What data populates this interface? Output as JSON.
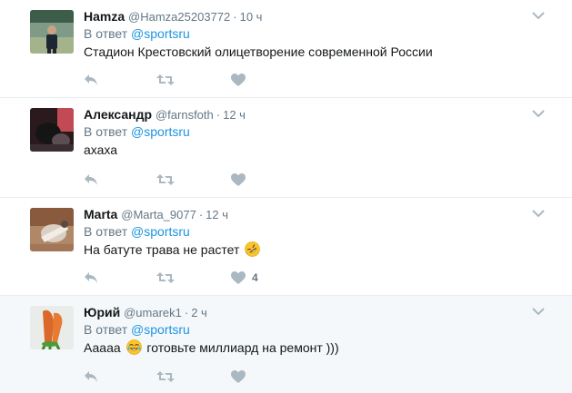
{
  "tweets": [
    {
      "name": "Hamza",
      "handle": "@Hamza25203772",
      "time": "10 ч",
      "reply_prefix": "В ответ",
      "reply_to": "@sportsru",
      "text": "Стадион Крестовский олицетворение современной России",
      "emoji": "",
      "text_after": "",
      "like_count": "",
      "highlighted": false
    },
    {
      "name": "Александр",
      "handle": "@farnsfoth",
      "time": "12 ч",
      "reply_prefix": "В ответ",
      "reply_to": "@sportsru",
      "text": "ахаха",
      "emoji": "",
      "text_after": "",
      "like_count": "",
      "highlighted": false
    },
    {
      "name": "Marta",
      "handle": "@Marta_9077",
      "time": "12 ч",
      "reply_prefix": "В ответ",
      "reply_to": "@sportsru",
      "text": "На батуте трава не растет",
      "emoji": "rolling-on-floor-laughing-emoji",
      "text_after": "",
      "like_count": "4",
      "highlighted": false
    },
    {
      "name": "Юрий",
      "handle": "@umarek1",
      "time": "2 ч",
      "reply_prefix": "В ответ",
      "reply_to": "@sportsru",
      "text": "Ааааа",
      "emoji": "tears-of-joy-emoji",
      "text_after": "готовьте миллиард на ремонт )))",
      "like_count": "",
      "highlighted": true
    }
  ],
  "icons": {
    "reply": "reply-icon",
    "retweet": "retweet-icon",
    "like": "heart-icon",
    "more": "chevron-down-icon"
  },
  "colors": {
    "name": "#14171a",
    "meta": "#657786",
    "mention": "#1b95e0",
    "action_icon": "#aab8c2",
    "highlight_bg": "#f5f8fa",
    "divider": "#e6ecf0"
  }
}
